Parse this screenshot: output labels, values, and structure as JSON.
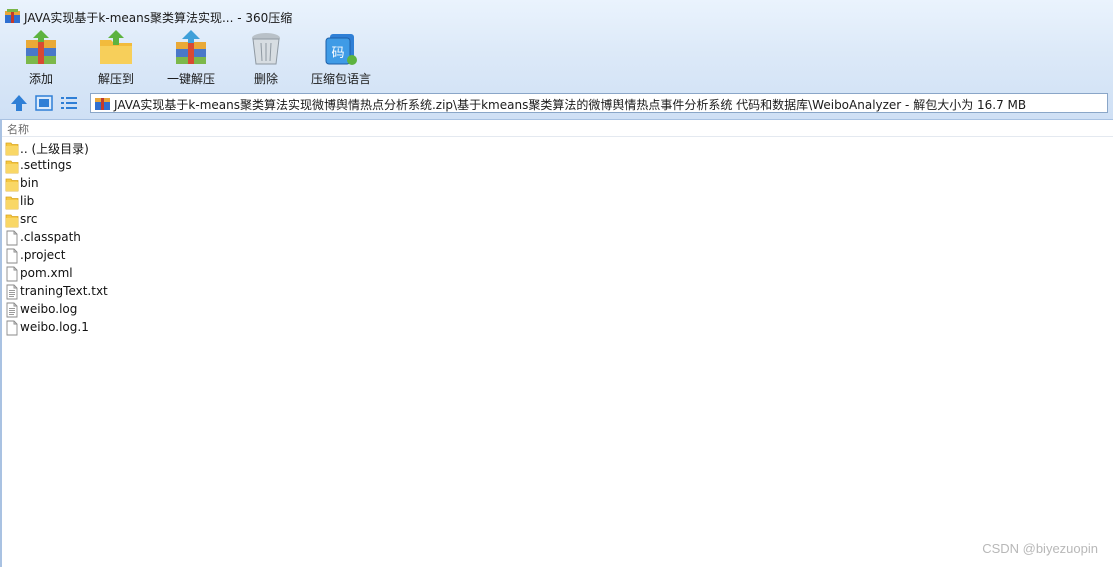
{
  "window": {
    "title": "JAVA实现基于k-means聚类算法实现... - 360压缩"
  },
  "toolbar": {
    "buttons": [
      {
        "label": "添加",
        "icon": "add-archive-icon"
      },
      {
        "label": "解压到",
        "icon": "extract-to-icon"
      },
      {
        "label": "一键解压",
        "icon": "one-click-extract-icon"
      },
      {
        "label": "删除",
        "icon": "delete-trash-icon"
      },
      {
        "label": "压缩包语言",
        "icon": "archive-language-icon"
      }
    ]
  },
  "nav": {
    "icons": [
      "up-arrow-icon",
      "thumbnail-view-icon",
      "list-view-icon"
    ],
    "path": "JAVA实现基于k-means聚类算法实现微博舆情热点分析系统.zip\\基于kmeans聚类算法的微博舆情热点事件分析系统 代码和数据库\\WeiboAnalyzer - 解包大小为 16.7 MB"
  },
  "list": {
    "header_name": "名称",
    "items": [
      {
        "name": ".. (上级目录)",
        "type": "folder"
      },
      {
        "name": ".settings",
        "type": "folder"
      },
      {
        "name": "bin",
        "type": "folder"
      },
      {
        "name": "lib",
        "type": "folder"
      },
      {
        "name": "src",
        "type": "folder"
      },
      {
        "name": ".classpath",
        "type": "file"
      },
      {
        "name": ".project",
        "type": "file"
      },
      {
        "name": "pom.xml",
        "type": "file"
      },
      {
        "name": "traningText.txt",
        "type": "text"
      },
      {
        "name": "weibo.log",
        "type": "text"
      },
      {
        "name": "weibo.log.1",
        "type": "file"
      }
    ]
  },
  "watermark": "CSDN @biyezuopin",
  "colors": {
    "folder": "#f5c842",
    "chrome_top": "#eaf3fd",
    "chrome_bottom": "#cfe0f5",
    "nav_blue": "#2f7fd6"
  }
}
